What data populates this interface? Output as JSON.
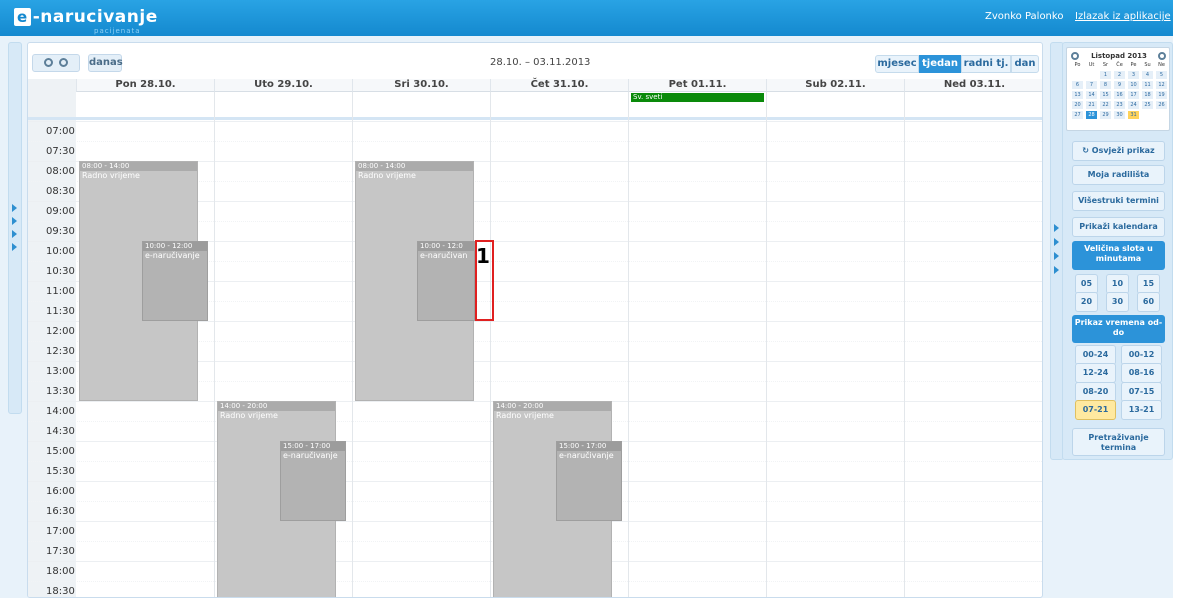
{
  "header": {
    "logo_mark": "e",
    "logo_text": "-narucivanje",
    "logo_sub": "pacijenata",
    "user": "Zvonko Palonko",
    "logout": "Izlazak iz aplikacije"
  },
  "toolbar": {
    "today": "danas",
    "date_range": "28.10. – 03.11.2013",
    "views": [
      "mjesec",
      "tjedan",
      "radni tj.",
      "dan"
    ],
    "active_view": "tjedan"
  },
  "days": [
    "Pon 28.10.",
    "Uto 29.10.",
    "Sri 30.10.",
    "Čet 31.10.",
    "Pet 01.11.",
    "Sub 02.11.",
    "Ned 03.11."
  ],
  "allday_event": "Sv. sveti",
  "times": [
    "07:00",
    "07:30",
    "08:00",
    "08:30",
    "09:00",
    "09:30",
    "10:00",
    "10:30",
    "11:00",
    "11:30",
    "12:00",
    "12:30",
    "13:00",
    "13:30",
    "14:00",
    "14:30",
    "15:00",
    "15:30",
    "16:00",
    "16:30",
    "17:00",
    "17:30",
    "18:00",
    "18:30"
  ],
  "events": {
    "mon_work": {
      "time": "08:00 - 14:00",
      "title": "Radno vrijeme"
    },
    "mon_en": {
      "time": "10:00 - 12:00",
      "title": "e-naručivanje"
    },
    "tue_work": {
      "time": "14:00 - 20:00",
      "title": "Radno vrijeme"
    },
    "tue_en": {
      "time": "15:00 - 17:00",
      "title": "e-naručivanje"
    },
    "wed_work": {
      "time": "08:00 - 14:00",
      "title": "Radno vrijeme"
    },
    "wed_en": {
      "time": "10:00 - 12:0",
      "title": "e-naručivan"
    },
    "thu_work": {
      "time": "14:00 - 20:00",
      "title": "Radno vrijeme"
    },
    "thu_en": {
      "time": "15:00 - 17:00",
      "title": "e-naručivanje"
    }
  },
  "marker_label": "1",
  "sidebar": {
    "calendar_title": "Listopad 2013",
    "weekdays": [
      "Po",
      "Ut",
      "Sr",
      "Če",
      "Pe",
      "Su",
      "Ne"
    ],
    "refresh": "Osvježi prikaz",
    "my_sites": "Moja radilišta",
    "multi": "Višestruki termini",
    "show_cal": "Prikaži kalendara",
    "slot_head": "Veličina slota u minutama",
    "slots": [
      "05",
      "10",
      "15",
      "20",
      "30",
      "60"
    ],
    "range_head": "Prikaz vremena od-do",
    "ranges": [
      "00-24",
      "00-12",
      "12-24",
      "08-16",
      "08-20",
      "07-15",
      "07-21",
      "13-21"
    ],
    "selected_range": "07-21",
    "search": "Pretraživanje termina"
  }
}
